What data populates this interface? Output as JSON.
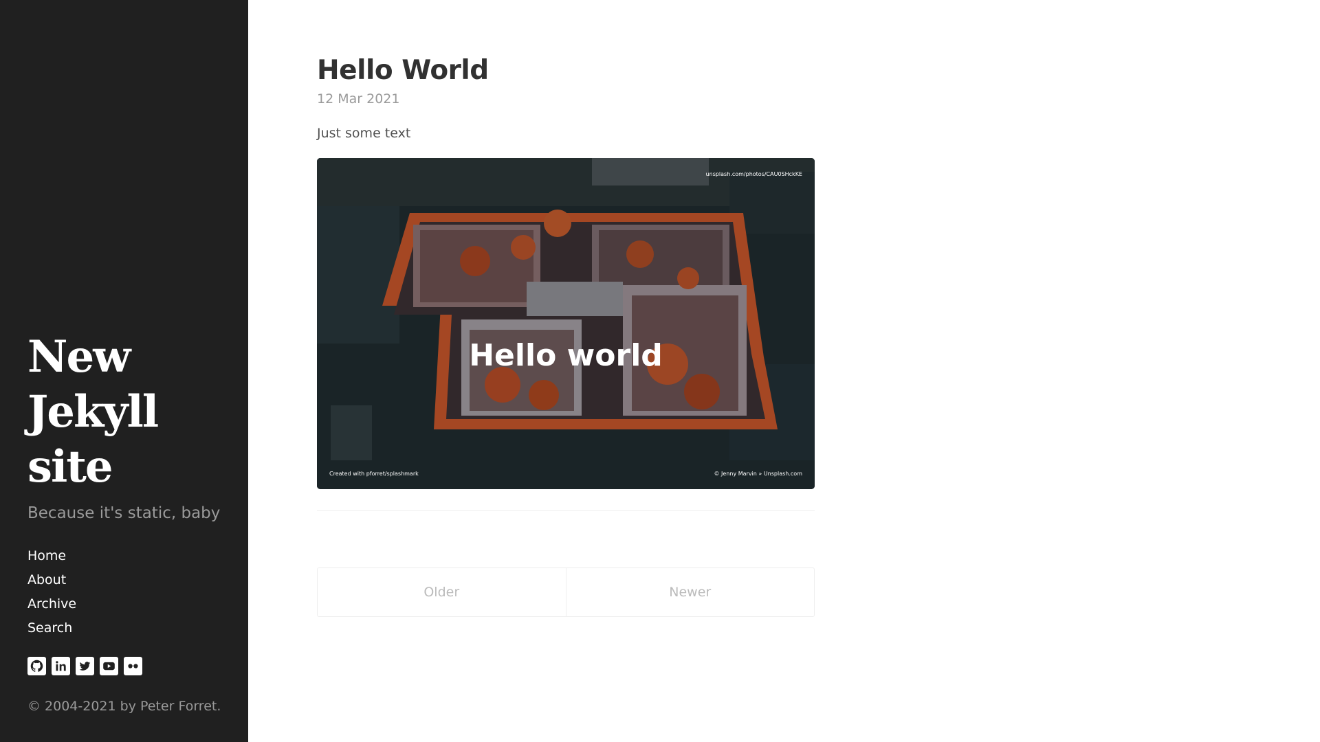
{
  "sidebar": {
    "title_lines": [
      "New",
      "Jekyll",
      "site"
    ],
    "tagline": "Because it's static, baby",
    "nav": [
      {
        "label": "Home"
      },
      {
        "label": "About"
      },
      {
        "label": "Archive"
      },
      {
        "label": "Search"
      }
    ],
    "social_icons": [
      "github-icon",
      "linkedin-icon",
      "twitter-icon",
      "youtube-icon",
      "flickr-icon"
    ],
    "copyright": "© 2004-2021 by Peter Forret."
  },
  "post": {
    "title": "Hello World",
    "date": "12 Mar 2021",
    "body": "Just some text",
    "image": {
      "headline": "Hello world",
      "source_url": "unsplash.com/photos/CAU0SHckKE",
      "created_with": "Created with pforret/splashmark",
      "credit": "© Jenny Marvin » Unsplash.com"
    }
  },
  "pagination": {
    "older": "Older",
    "newer": "Newer"
  },
  "colors": {
    "sidebar_bg": "#202020",
    "text": "#515151",
    "muted": "#9a9a9a",
    "roof_tiles": "#c2542a"
  }
}
